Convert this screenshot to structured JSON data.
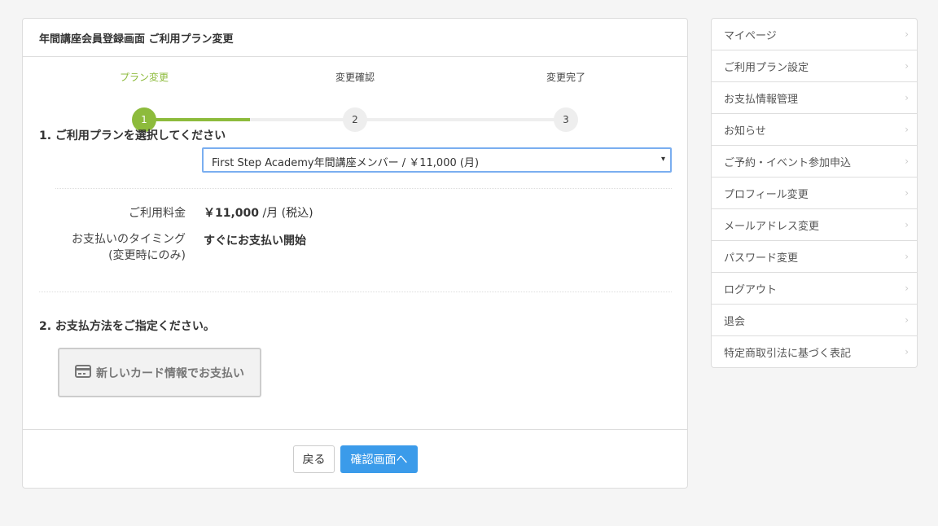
{
  "header": {
    "title": "年間講座会員登録画面 ご利用プラン変更"
  },
  "steps": [
    {
      "label": "プラン変更",
      "number": "1"
    },
    {
      "label": "変更確認",
      "number": "2"
    },
    {
      "label": "変更完了",
      "number": "3"
    }
  ],
  "section1": {
    "title": "1. ご利用プランを選択してください",
    "select_value": "First Step Academy年間講座メンバー / ￥11,000 (月)",
    "select_caret": "▾"
  },
  "fee": {
    "label": "ご利用料金",
    "amount": "￥11,000",
    "unit": " /月 (税込)"
  },
  "timing": {
    "label_line1": "お支払いのタイミング",
    "label_line2": "(変更時にのみ)",
    "value": "すぐにお支払い開始"
  },
  "section2": {
    "title": "2. お支払方法をご指定ください。",
    "card_button": "新しいカード情報でお支払い"
  },
  "footer": {
    "back": "戻る",
    "confirm": "確認画面へ"
  },
  "sidebar": {
    "chevron": "›",
    "items": [
      {
        "label": "マイページ"
      },
      {
        "label": "ご利用プラン設定"
      },
      {
        "label": "お支払情報管理"
      },
      {
        "label": "お知らせ"
      },
      {
        "label": "ご予約・イベント参加申込"
      },
      {
        "label": "プロフィール変更"
      },
      {
        "label": "メールアドレス変更"
      },
      {
        "label": "パスワード変更"
      },
      {
        "label": "ログアウト"
      },
      {
        "label": "退会"
      },
      {
        "label": "特定商取引法に基づく表記"
      }
    ]
  },
  "colors": {
    "accent_green": "#8dbb3c",
    "primary_blue": "#3b9bea",
    "select_border": "#7aaef0"
  }
}
